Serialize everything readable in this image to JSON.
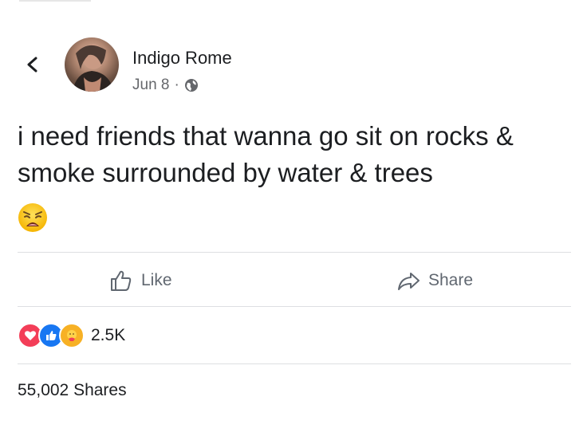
{
  "author": {
    "name": "Indigo Rome",
    "date": "Jun 8",
    "separator": "·",
    "privacy_icon": "globe-icon"
  },
  "post": {
    "text": "i need friends that wanna go sit on rocks & smoke surrounded by water & trees",
    "emoji": "weary-face-emoji"
  },
  "actions": {
    "like_label": "Like",
    "share_label": "Share"
  },
  "reactions": {
    "types": [
      "love",
      "like",
      "care"
    ],
    "count": "2.5K"
  },
  "shares_text": "55,002 Shares",
  "colors": {
    "text": "#1c1e21",
    "meta": "#65676b",
    "love": "#f33e58",
    "like": "#1877f2",
    "care": "#f7b125",
    "divider": "#dddfe2"
  }
}
